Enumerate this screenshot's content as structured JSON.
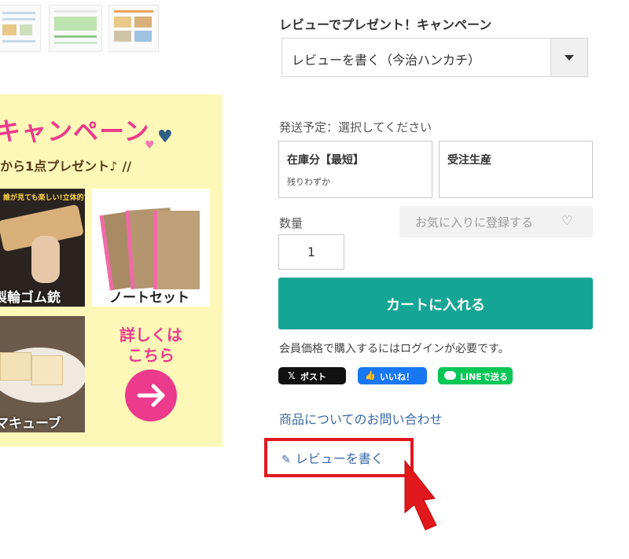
{
  "banner": {
    "title": "キャンペーン",
    "subtitle": "から1点プレゼント♪",
    "tile_gun_caption": "製輪ゴム銃",
    "tile_gun_note": "誰が見ても楽しい!立体的でリアルゴム銃",
    "tile_notebook_caption": "ノートセット",
    "tile_cube_caption": "マキューブ",
    "details_line1": "詳しくは",
    "details_line2": "こちら"
  },
  "campaign": {
    "label": "レビューでプレゼント！キャンペーン",
    "selected": "レビューを書く（今治ハンカチ）"
  },
  "shipping": {
    "label": "発送予定：選択してください",
    "options": [
      {
        "title": "在庫分【最短】",
        "sub": "残りわずか"
      },
      {
        "title": "受注生産",
        "sub": ""
      }
    ]
  },
  "quantity": {
    "label": "数量",
    "value": "1"
  },
  "favorite": {
    "label": "お気に入りに登録する",
    "icon": "heart-outline-icon"
  },
  "cart": {
    "label": "カートに入れる",
    "color": "#15a594"
  },
  "member_note": "会員価格で購入するにはログインが必要です。",
  "social": {
    "x_post": "ポスト",
    "fb_like": "いいね！",
    "line_send": "LINEで送る"
  },
  "inquiry_link": "商品についてのお問い合わせ",
  "review_link": "レビューを書く",
  "colors": {
    "accent": "#15a594",
    "highlight": "#e0181e",
    "link": "#3b6aa8",
    "banner_bg": "#fdf8b8",
    "banner_pink": "#ec3a8c"
  }
}
